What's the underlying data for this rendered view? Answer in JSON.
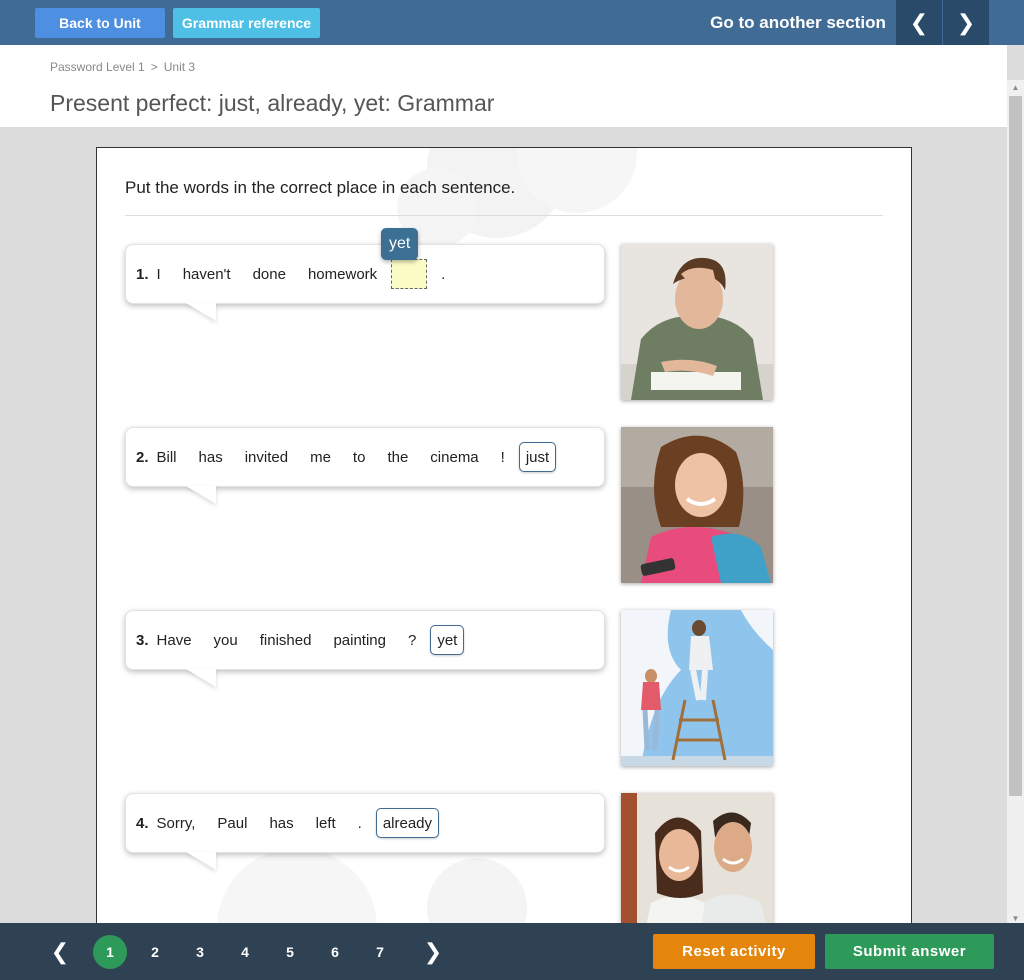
{
  "topbar": {
    "back_label": "Back to Unit",
    "grammar_label": "Grammar reference",
    "go_section_label": "Go to another section",
    "prev_glyph": "❮",
    "next_glyph": "❯"
  },
  "breadcrumb": {
    "course": "Password Level 1",
    "separator": ">",
    "unit": "Unit 3"
  },
  "page_title": "Present perfect: just, already, yet: Grammar",
  "activity": {
    "instruction": "Put the words in the correct place in each sentence.",
    "dragging_word": "yet",
    "items": [
      {
        "number": "1.",
        "words": [
          "I",
          "haven't",
          "done",
          "homework"
        ],
        "end": ".",
        "chip": "",
        "photo": "student-stressed"
      },
      {
        "number": "2.",
        "words": [
          "Bill",
          "has",
          "invited",
          "me",
          "to",
          "the",
          "cinema",
          "!"
        ],
        "chip": "just",
        "photo": "girl-smiling"
      },
      {
        "number": "3.",
        "words": [
          "Have",
          "you",
          "finished",
          "painting",
          "?"
        ],
        "chip": "yet",
        "photo": "painting-wall"
      },
      {
        "number": "4.",
        "words": [
          "Sorry,",
          "Paul",
          "has",
          "left",
          "."
        ],
        "chip": "already",
        "photo": "couple-smiling"
      }
    ]
  },
  "pagination": {
    "prev_glyph": "❮",
    "next_glyph": "❯",
    "pages": [
      "1",
      "2",
      "3",
      "4",
      "5",
      "6",
      "7"
    ],
    "active": "1"
  },
  "actions": {
    "reset_label": "Reset activity",
    "submit_label": "Submit answer"
  },
  "colors": {
    "topbar": "#3f6b95",
    "back_button": "#4d8fe0",
    "grammar_button": "#4ec0e6",
    "bottombar": "#2f4254",
    "active_page": "#2e9a5a",
    "reset": "#e4860c",
    "submit": "#2e9a5a"
  }
}
